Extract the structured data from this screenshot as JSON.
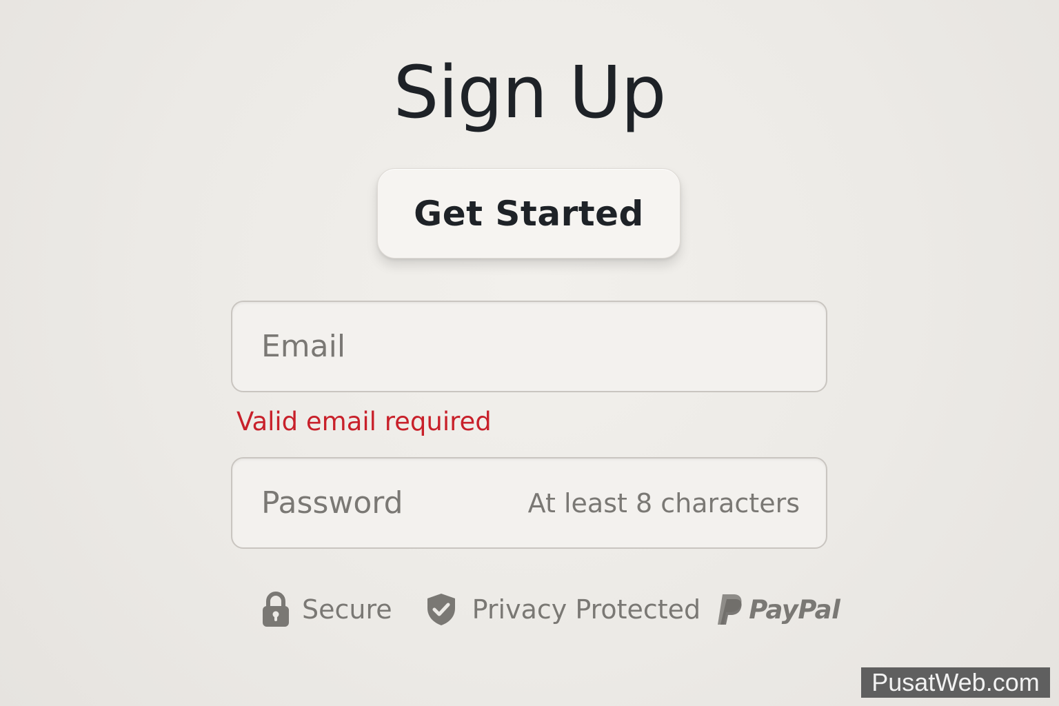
{
  "page": {
    "title": "Sign Up"
  },
  "cta": {
    "label": "Get Started"
  },
  "form": {
    "email": {
      "placeholder": "Email",
      "value": "",
      "error": "Valid email required"
    },
    "password": {
      "placeholder": "Password",
      "value": "",
      "hint": "At least 8 characters"
    }
  },
  "trust_badges": [
    {
      "label": "Secure",
      "icon": "lock-icon"
    },
    {
      "label": "Privacy Protected",
      "icon": "shield-check-icon"
    },
    {
      "label": "PayPal",
      "icon": "paypal-logo-icon"
    }
  ],
  "watermark": {
    "text": "PusatWeb.com"
  },
  "colors": {
    "background": "#ECEAE6",
    "text_primary": "#1E2227",
    "text_muted": "#7A7874",
    "error": "#C8202A",
    "field_border": "#C9C5C0"
  }
}
